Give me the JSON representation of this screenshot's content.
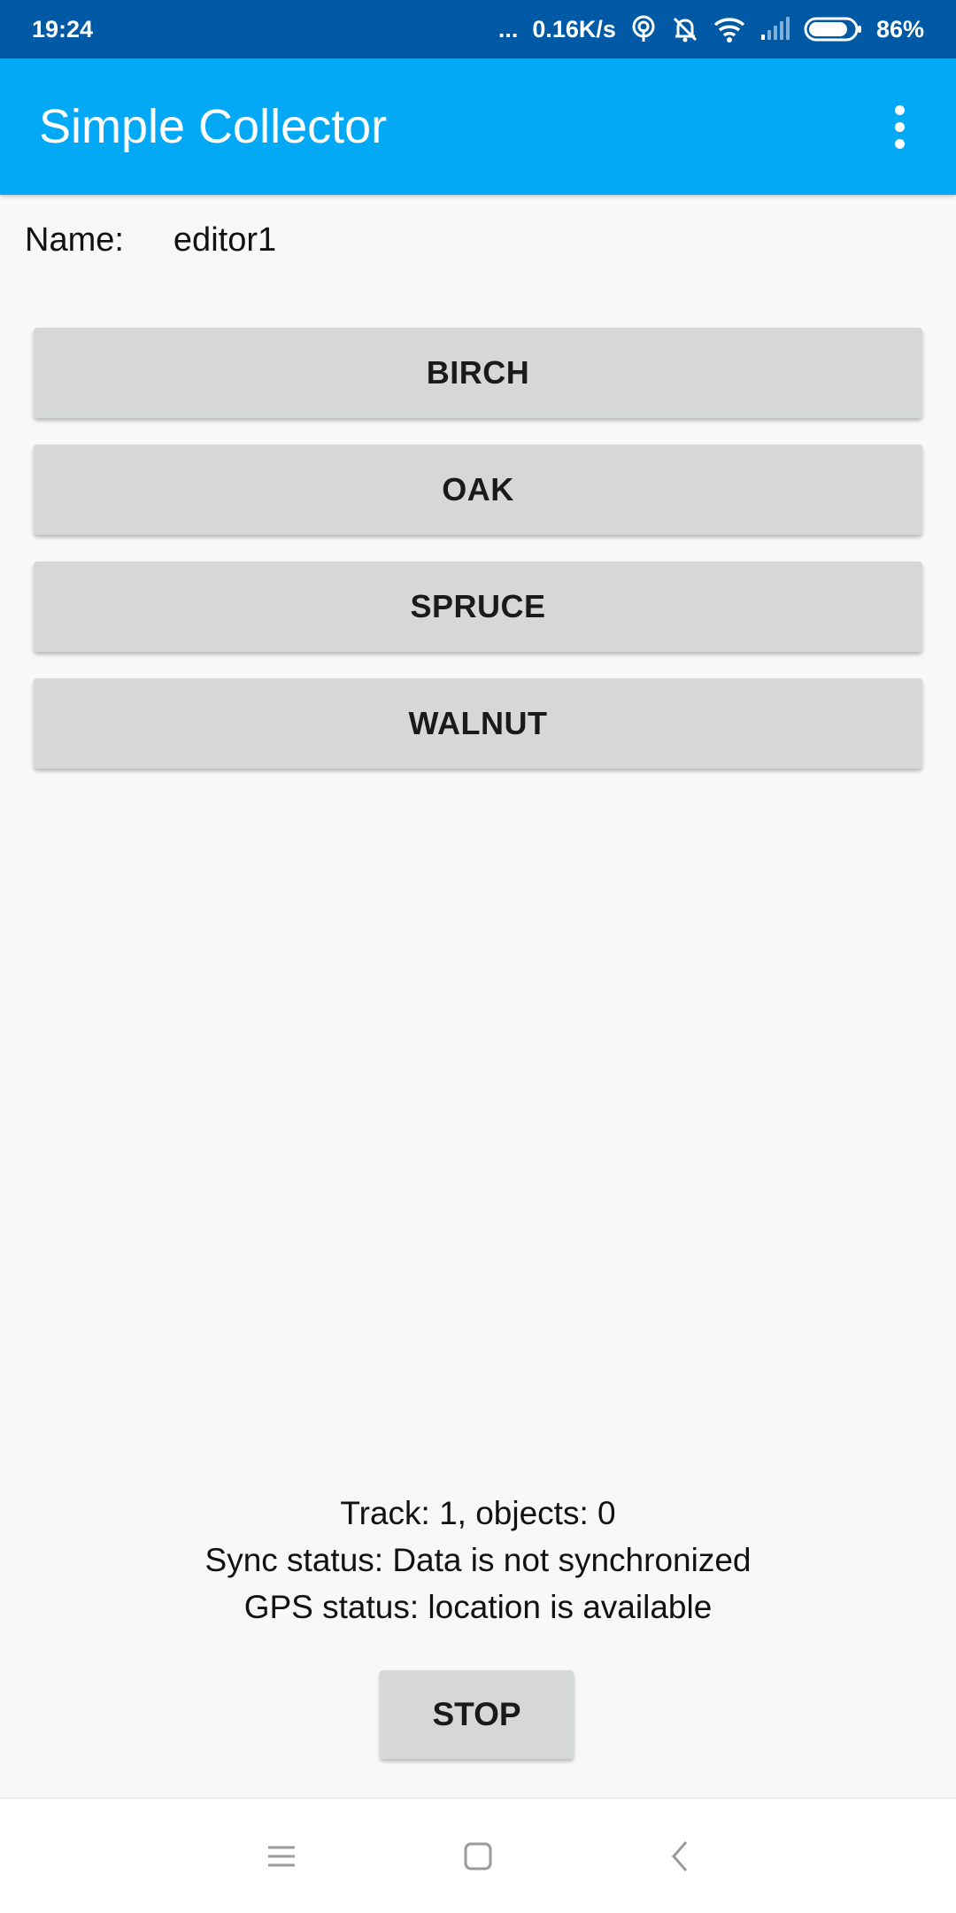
{
  "status_bar": {
    "time": "19:24",
    "dots": "...",
    "network_speed": "0.16K/s",
    "battery_percent": "86%",
    "battery_level": 0.86,
    "icons": [
      "hotspot-icon",
      "mute-bell-icon",
      "wifi-icon",
      "signal-icon",
      "battery-icon"
    ]
  },
  "app_bar": {
    "title": "Simple Collector",
    "overflow_icon": "more-vert-icon"
  },
  "form": {
    "name_label": "Name:",
    "name_value": "editor1"
  },
  "tree_buttons": [
    "BIRCH",
    "OAK",
    "SPRUCE",
    "WALNUT"
  ],
  "status_info": {
    "track": "Track: 1, objects: 0",
    "sync": "Sync status: Data is not synchronized",
    "gps": "GPS status: location is available"
  },
  "stop_button": {
    "label": "STOP"
  },
  "nav_bar": {
    "icons": [
      "menu-icon",
      "home-icon",
      "back-icon"
    ]
  },
  "colors": {
    "status_bar": "#0059a4",
    "app_bar": "#03a9f4",
    "background": "#f8f8f8",
    "button": "#d6d7d7"
  }
}
